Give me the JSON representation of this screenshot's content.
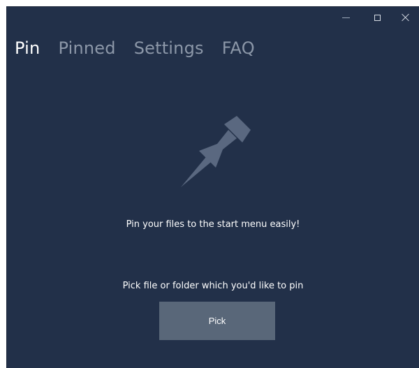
{
  "window": {
    "controls": {
      "minimize": "minimize-icon",
      "maximize": "maximize-icon",
      "close": "close-icon"
    }
  },
  "nav": {
    "tabs": [
      {
        "label": "Pin",
        "active": true
      },
      {
        "label": "Pinned",
        "active": false
      },
      {
        "label": "Settings",
        "active": false
      },
      {
        "label": "FAQ",
        "active": false
      }
    ]
  },
  "main": {
    "icon": "pushpin-icon",
    "tagline": "Pin your files to the start menu easily!",
    "instruction": "Pick file or folder which you'd like to pin",
    "pick_label": "Pick"
  },
  "colors": {
    "background": "#223049",
    "active_tab": "#ffffff",
    "inactive_tab": "#8c97a8",
    "button": "#596779",
    "icon": "#5a6880"
  }
}
